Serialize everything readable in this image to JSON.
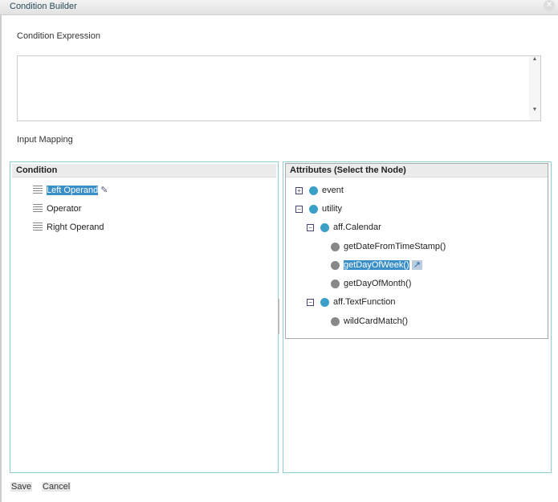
{
  "window": {
    "title": "Condition Builder",
    "close_icon": "close-icon"
  },
  "expression": {
    "label": "Condition Expression",
    "value": ""
  },
  "mapping": {
    "label": "Input Mapping"
  },
  "condition_panel": {
    "header": "Condition",
    "items": [
      {
        "label": "Left Operand",
        "selected": true
      },
      {
        "label": "Operator"
      },
      {
        "label": "Right Operand"
      }
    ]
  },
  "attributes_panel": {
    "header": "Attributes (Select the Node)",
    "nodes": [
      {
        "label": "event",
        "toggle": "+"
      },
      {
        "label": "utility",
        "toggle": "−"
      },
      {
        "label": "aff.Calendar",
        "toggle": "−"
      },
      {
        "label": "getDateFromTimeStamp()"
      },
      {
        "label": "getDayOfWeek()",
        "selected": true
      },
      {
        "label": "getDayOfMonth()"
      },
      {
        "label": "aff.TextFunction",
        "toggle": "−"
      },
      {
        "label": "wildCardMatch()"
      }
    ]
  },
  "buttons": {
    "save": "Save",
    "cancel": "Cancel"
  },
  "colors": {
    "selection": "#3a8fc8",
    "panel_border": "#8fcfcf"
  }
}
